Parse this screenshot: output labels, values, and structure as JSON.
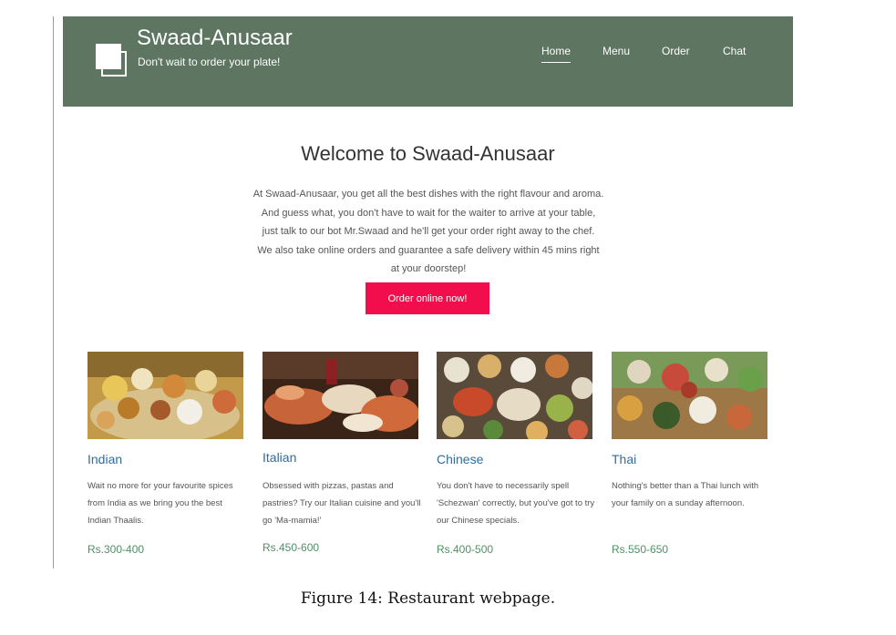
{
  "header": {
    "brand": "Swaad-Anusaar",
    "tagline": "Don't wait to order your plate!",
    "nav": [
      "Home",
      "Menu",
      "Order",
      "Chat"
    ],
    "active_nav": "Home",
    "bg_color": "#5d7561"
  },
  "hero": {
    "title": "Welcome to Swaad-Anusaar",
    "lines": [
      "At Swaad-Anusaar, you get all the best dishes with the right flavour and aroma.",
      "And guess what, you don't have to wait for the waiter to arrive at your table,",
      "just talk to our bot Mr.Swaad and he'll get your order right away to the chef.",
      "We also take online orders and guarantee a safe delivery within 45 mins right",
      "at your doorstep!"
    ],
    "cta_label": "Order online now!",
    "cta_color": "#f20e4d"
  },
  "cards": [
    {
      "title": "Indian",
      "desc": "Wait no more for your favourite spices from India as we bring you the best Indian Thaalis.",
      "price": "Rs.300-400"
    },
    {
      "title": "Italian",
      "desc": "Obsessed with pizzas, pastas and pastries? Try our Italian cuisine and you'll go 'Ma-mamia!'",
      "price": "Rs.450-600"
    },
    {
      "title": "Chinese",
      "desc": "You don't have to necessarily spell 'Schezwan' correctly, but you've got to try our Chinese specials.",
      "price": "Rs.400-500"
    },
    {
      "title": "Thai",
      "desc": "Nothing's better than a Thai lunch with your family on a sunday afternoon.",
      "price": "Rs.550-650"
    }
  ],
  "caption": "Figure 14: Restaurant webpage."
}
